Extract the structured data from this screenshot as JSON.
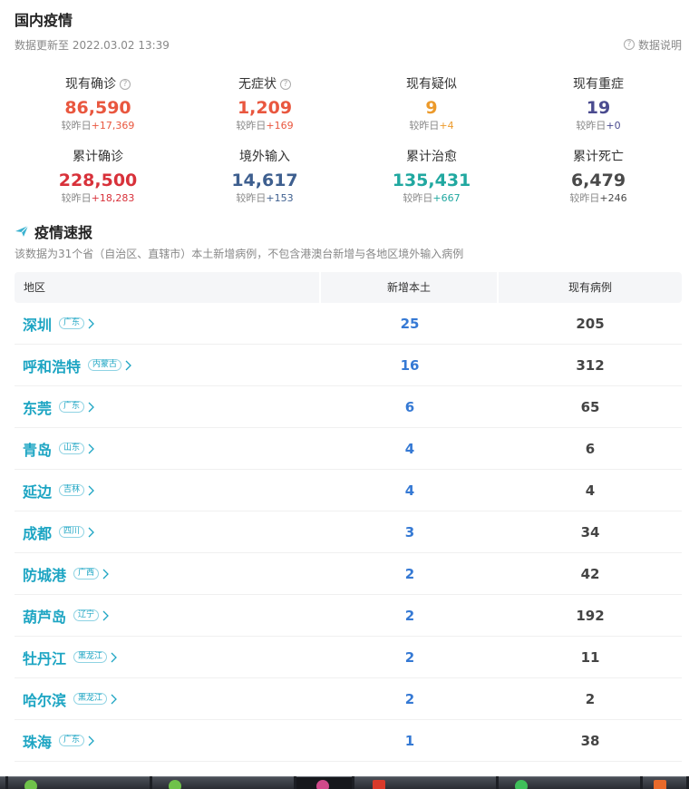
{
  "header": {
    "title": "国内疫情",
    "update_time": "数据更新至 2022.03.02 13:39",
    "explain_label": "数据说明"
  },
  "stats": {
    "row1": [
      {
        "label": "现有确诊",
        "value": "86,590",
        "delta_prefix": "较昨日",
        "delta": "+17,369",
        "color": "#e9573f",
        "help": true
      },
      {
        "label": "无症状",
        "value": "1,209",
        "delta_prefix": "较昨日",
        "delta": "+169",
        "color": "#e9573f",
        "help": true
      },
      {
        "label": "现有疑似",
        "value": "9",
        "delta_prefix": "较昨日",
        "delta": "+4",
        "color": "#ec9a2b",
        "help": false
      },
      {
        "label": "现有重症",
        "value": "19",
        "delta_prefix": "较昨日",
        "delta": "+0",
        "color": "#4a4b8f",
        "help": false
      }
    ],
    "row2": [
      {
        "label": "累计确诊",
        "value": "228,500",
        "delta_prefix": "较昨日",
        "delta": "+18,283",
        "color": "#d8313a",
        "help": false
      },
      {
        "label": "境外输入",
        "value": "14,617",
        "delta_prefix": "较昨日",
        "delta": "+153",
        "color": "#3e5f8f",
        "help": false
      },
      {
        "label": "累计治愈",
        "value": "135,431",
        "delta_prefix": "较昨日",
        "delta": "+667",
        "color": "#20a8a0",
        "help": false
      },
      {
        "label": "累计死亡",
        "value": "6,479",
        "delta_prefix": "较昨日",
        "delta": "+246",
        "color": "#4a4a4a",
        "help": false
      }
    ]
  },
  "section": {
    "title": "疫情速报",
    "desc": "该数据为31个省（自治区、直辖市）本土新增病例，不包含港澳台新增与各地区境外输入病例"
  },
  "table": {
    "headers": {
      "region": "地区",
      "new_local": "新增本土",
      "current": "现有病例"
    },
    "rows": [
      {
        "city": "深圳",
        "province": "广东",
        "new_local": "25",
        "current": "205"
      },
      {
        "city": "呼和浩特",
        "province": "内蒙古",
        "new_local": "16",
        "current": "312"
      },
      {
        "city": "东莞",
        "province": "广东",
        "new_local": "6",
        "current": "65"
      },
      {
        "city": "青岛",
        "province": "山东",
        "new_local": "4",
        "current": "6"
      },
      {
        "city": "延边",
        "province": "吉林",
        "new_local": "4",
        "current": "4"
      },
      {
        "city": "成都",
        "province": "四川",
        "new_local": "3",
        "current": "34"
      },
      {
        "city": "防城港",
        "province": "广西",
        "new_local": "2",
        "current": "42"
      },
      {
        "city": "葫芦岛",
        "province": "辽宁",
        "new_local": "2",
        "current": "192"
      },
      {
        "city": "牡丹江",
        "province": "黑龙江",
        "new_local": "2",
        "current": "11"
      },
      {
        "city": "哈尔滨",
        "province": "黑龙江",
        "new_local": "2",
        "current": "2"
      },
      {
        "city": "珠海",
        "province": "广东",
        "new_local": "1",
        "current": "38"
      }
    ]
  },
  "colors": {
    "accent": "#1da5c3",
    "new_local": "#3579d4"
  }
}
